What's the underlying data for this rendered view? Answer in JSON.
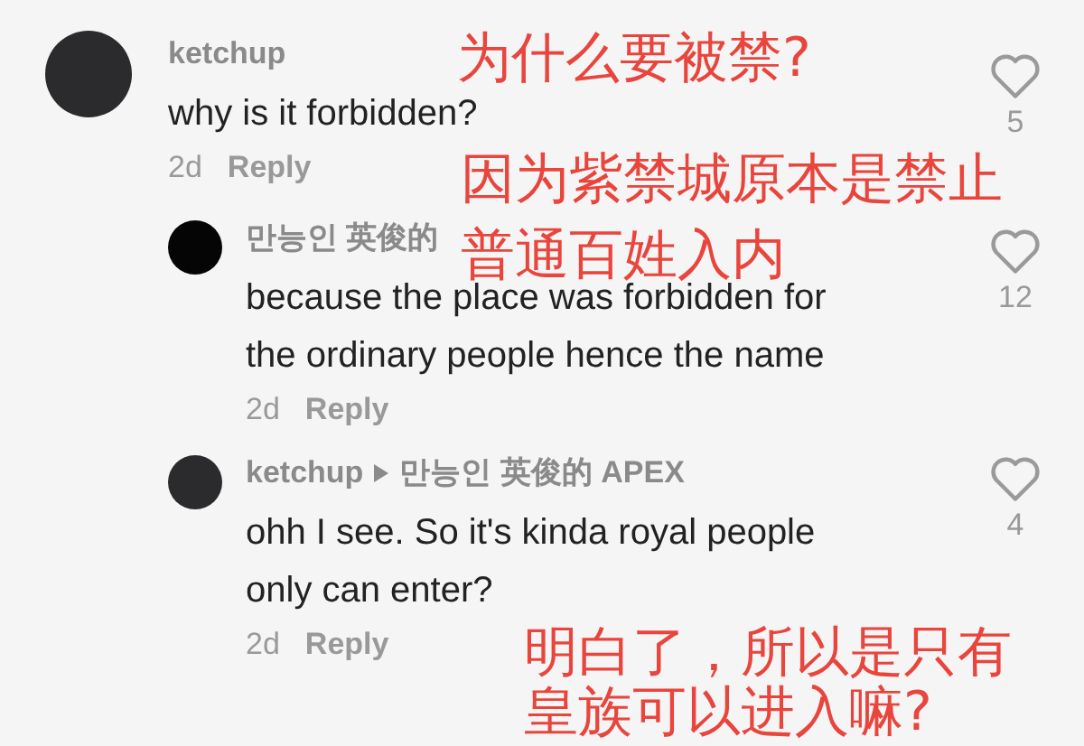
{
  "comments": [
    {
      "username": "ketchup",
      "text": "why is it forbidden?",
      "age": "2d",
      "reply": "Reply",
      "likes": "5",
      "liked": false,
      "children": [
        {
          "username": "만능인 英俊的",
          "text": "because the place was forbidden for the ordinary people hence the name",
          "age": "2d",
          "reply": "Reply",
          "likes": "12",
          "liked": false
        },
        {
          "username": "ketchup",
          "reply_to": "만능인 英俊的 APEX",
          "text": "ohh I see. So it's kinda royal people only can enter?",
          "age": "2d",
          "reply": "Reply",
          "likes": "4",
          "liked": false
        }
      ]
    }
  ],
  "annotations": [
    "为什么要被禁?",
    "因为紫禁城原本是禁止",
    "普通百姓入内",
    "明白了，所以是只有",
    "皇族可以进入嘛?"
  ]
}
